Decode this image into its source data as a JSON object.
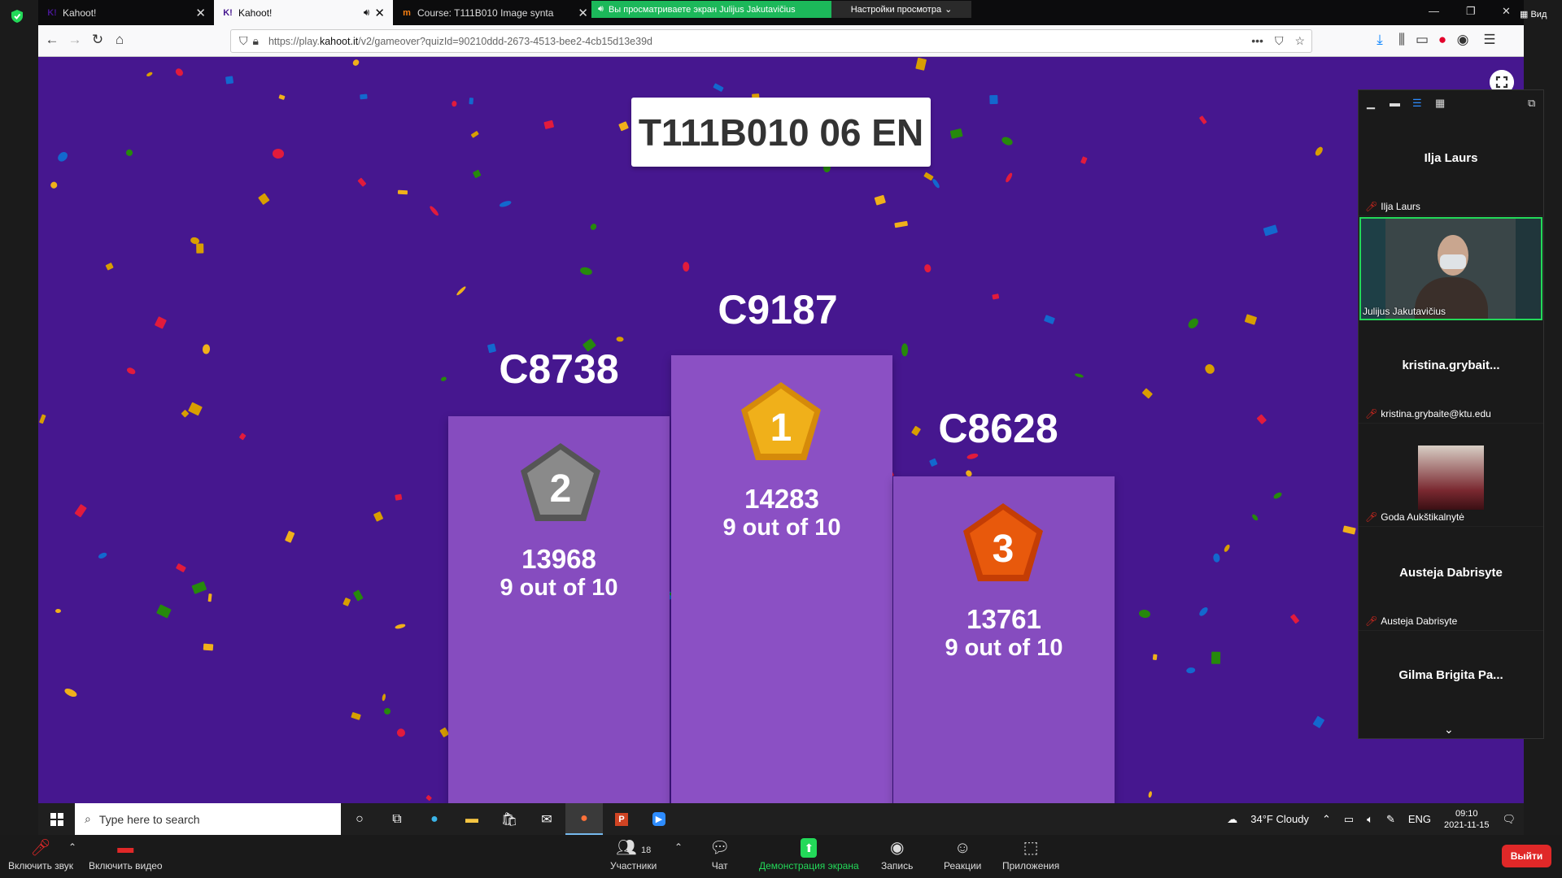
{
  "browser": {
    "tabs": [
      {
        "title": "Kahoot!",
        "favicon": "kahoot-favicon"
      },
      {
        "title": "Kahoot!",
        "favicon": "kahoot-favicon"
      },
      {
        "title": "Course: T111B010 Image synta",
        "favicon": "moodle-favicon"
      }
    ],
    "url_prefix": "https://play.",
    "url_domain": "kahoot.it",
    "url_path": "/v2/gameover?quizId=90210ddd-2673-4513-bee2-4cb15d13e39d"
  },
  "zoom_share": {
    "banner": "Вы просматриваете экран Julijus Jakutavičius",
    "view_settings": "Настройки просмотра",
    "view_label": "Вид"
  },
  "kahoot": {
    "quiz_title": "T111B010 06 EN",
    "podium": [
      {
        "rank": "1",
        "name": "C9187",
        "score": "14283",
        "correct": "9 out of 10",
        "medal_color": "#f0b01a"
      },
      {
        "rank": "2",
        "name": "C8738",
        "score": "13968",
        "correct": "9 out of 10",
        "medal_color": "#8a8a8a"
      },
      {
        "rank": "3",
        "name": "C8628",
        "score": "13761",
        "correct": "9 out of 10",
        "medal_color": "#e8590c"
      }
    ]
  },
  "participants_panel": {
    "tiles": [
      {
        "display": "Ilja Laurs",
        "label": "Ilja Laurs"
      },
      {
        "display": "",
        "label": "Julijus Jakutavičius"
      },
      {
        "display": "kristina.grybait...",
        "label": "kristina.grybaite@ktu.edu"
      },
      {
        "display": "",
        "label": "Goda Aukštikalnytė"
      },
      {
        "display": "Austeja Dabrisyte",
        "label": "Austeja Dabrisyte"
      },
      {
        "display": "Gilma Brigita Pa...",
        "label": ""
      }
    ]
  },
  "taskbar": {
    "search_placeholder": "Type here to search",
    "weather_temp": "34°F",
    "weather_text": "Cloudy",
    "lang": "ENG",
    "time": "09:10",
    "date": "2021-11-15"
  },
  "zoom_toolbar": {
    "unmute": "Включить звук",
    "start_video": "Включить видео",
    "participants": "Участники",
    "participants_count": "18",
    "chat": "Чат",
    "share_screen": "Демонстрация экрана",
    "record": "Запись",
    "reactions": "Реакции",
    "apps": "Приложения",
    "leave": "Выйти"
  },
  "colors": {
    "stage_bg": "#46178f",
    "platform": "#864cbf",
    "zoom_green": "#23d959",
    "leave_red": "#e02828"
  }
}
